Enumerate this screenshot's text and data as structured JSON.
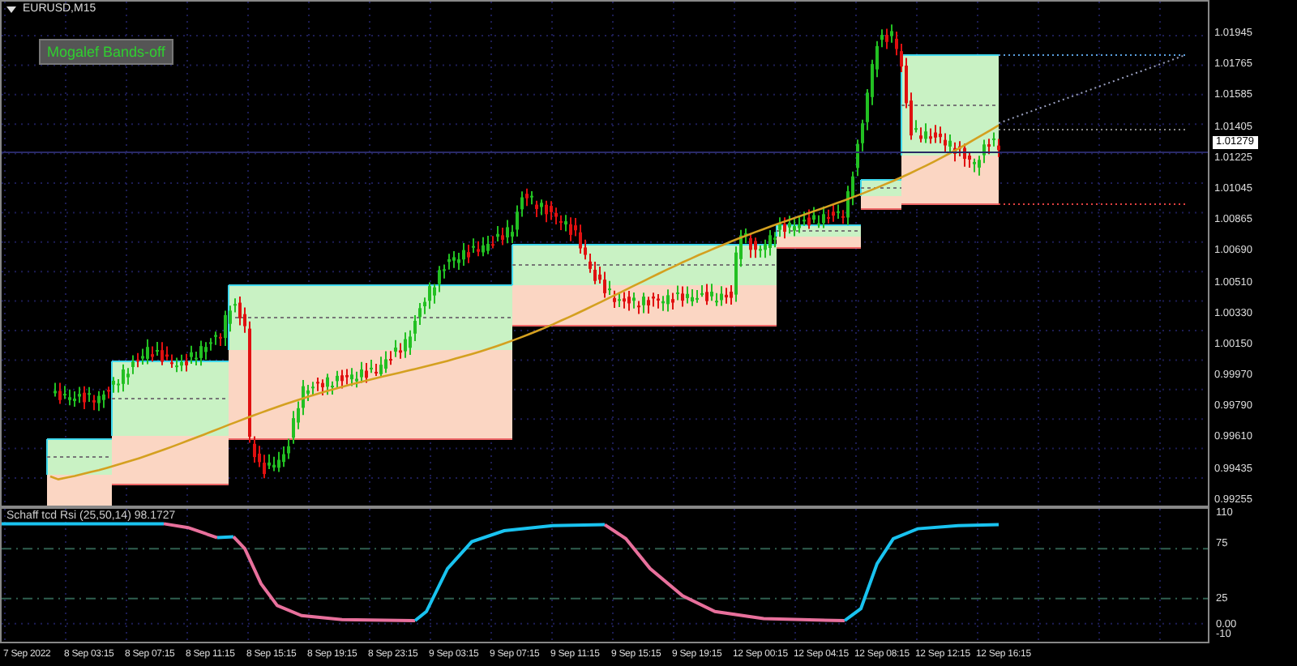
{
  "chart": {
    "symbol": "EURUSD,M15",
    "toggle_button": "Mogalef Bands-off",
    "current_price": "1.01279",
    "price_axis": [
      "1.01945",
      "1.01765",
      "1.01585",
      "1.01405",
      "1.01225",
      "1.01045",
      "1.00865",
      "1.00690",
      "1.00510",
      "1.00330",
      "1.00150",
      "0.99970",
      "0.99790",
      "0.99610",
      "0.99435",
      "0.99255"
    ]
  },
  "indicator": {
    "label": "Schaff tcd Rsi (25,50,14) 98.1727",
    "axis": [
      "110",
      "75",
      "25",
      "0.00",
      "-10"
    ]
  },
  "time_axis": [
    "7 Sep 2022",
    "8 Sep 03:15",
    "8 Sep 07:15",
    "8 Sep 11:15",
    "8 Sep 15:15",
    "8 Sep 19:15",
    "8 Sep 23:15",
    "9 Sep 03:15",
    "9 Sep 07:15",
    "9 Sep 11:15",
    "9 Sep 15:15",
    "9 Sep 19:15",
    "12 Sep 00:15",
    "12 Sep 04:15",
    "12 Sep 08:15",
    "12 Sep 12:15",
    "12 Sep 16:15"
  ]
}
